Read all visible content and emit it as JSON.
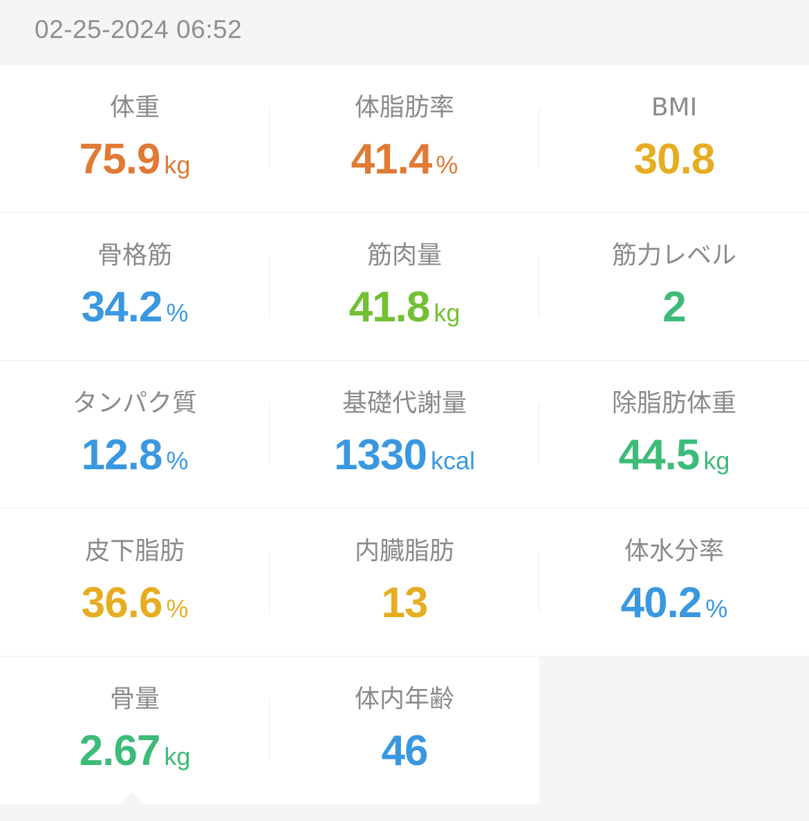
{
  "header": {
    "datetime": "02-25-2024 06:52"
  },
  "colors": {
    "orange": "#e07a35",
    "amber": "#e6ad22",
    "blue": "#3a98e0",
    "green_lime": "#72c033",
    "green": "#3dbb78",
    "label_gray": "#8a8a8a"
  },
  "metrics": [
    {
      "label": "体重",
      "value": "75.9",
      "unit": "kg",
      "color": "#e07a35"
    },
    {
      "label": "体脂肪率",
      "value": "41.4",
      "unit": "%",
      "color": "#e07a35"
    },
    {
      "label": "BMI",
      "value": "30.8",
      "unit": "",
      "color": "#e6ad22"
    },
    {
      "label": "骨格筋",
      "value": "34.2",
      "unit": "%",
      "color": "#3a98e0"
    },
    {
      "label": "筋肉量",
      "value": "41.8",
      "unit": "kg",
      "color": "#72c033"
    },
    {
      "label": "筋力レベル",
      "value": "2",
      "unit": "",
      "color": "#3dbb78"
    },
    {
      "label": "タンパク質",
      "value": "12.8",
      "unit": "%",
      "color": "#3a98e0"
    },
    {
      "label": "基礎代謝量",
      "value": "1330",
      "unit": "kcal",
      "color": "#3a98e0"
    },
    {
      "label": "除脂肪体重",
      "value": "44.5",
      "unit": "kg",
      "color": "#3dbb78"
    },
    {
      "label": "皮下脂肪",
      "value": "36.6",
      "unit": "%",
      "color": "#e6ad22"
    },
    {
      "label": "内臓脂肪",
      "value": "13",
      "unit": "",
      "color": "#e6ad22"
    },
    {
      "label": "体水分率",
      "value": "40.2",
      "unit": "%",
      "color": "#3a98e0"
    },
    {
      "label": "骨量",
      "value": "2.67",
      "unit": "kg",
      "color": "#3dbb78"
    },
    {
      "label": "体内年齢",
      "value": "46",
      "unit": "",
      "color": "#3a98e0"
    }
  ]
}
